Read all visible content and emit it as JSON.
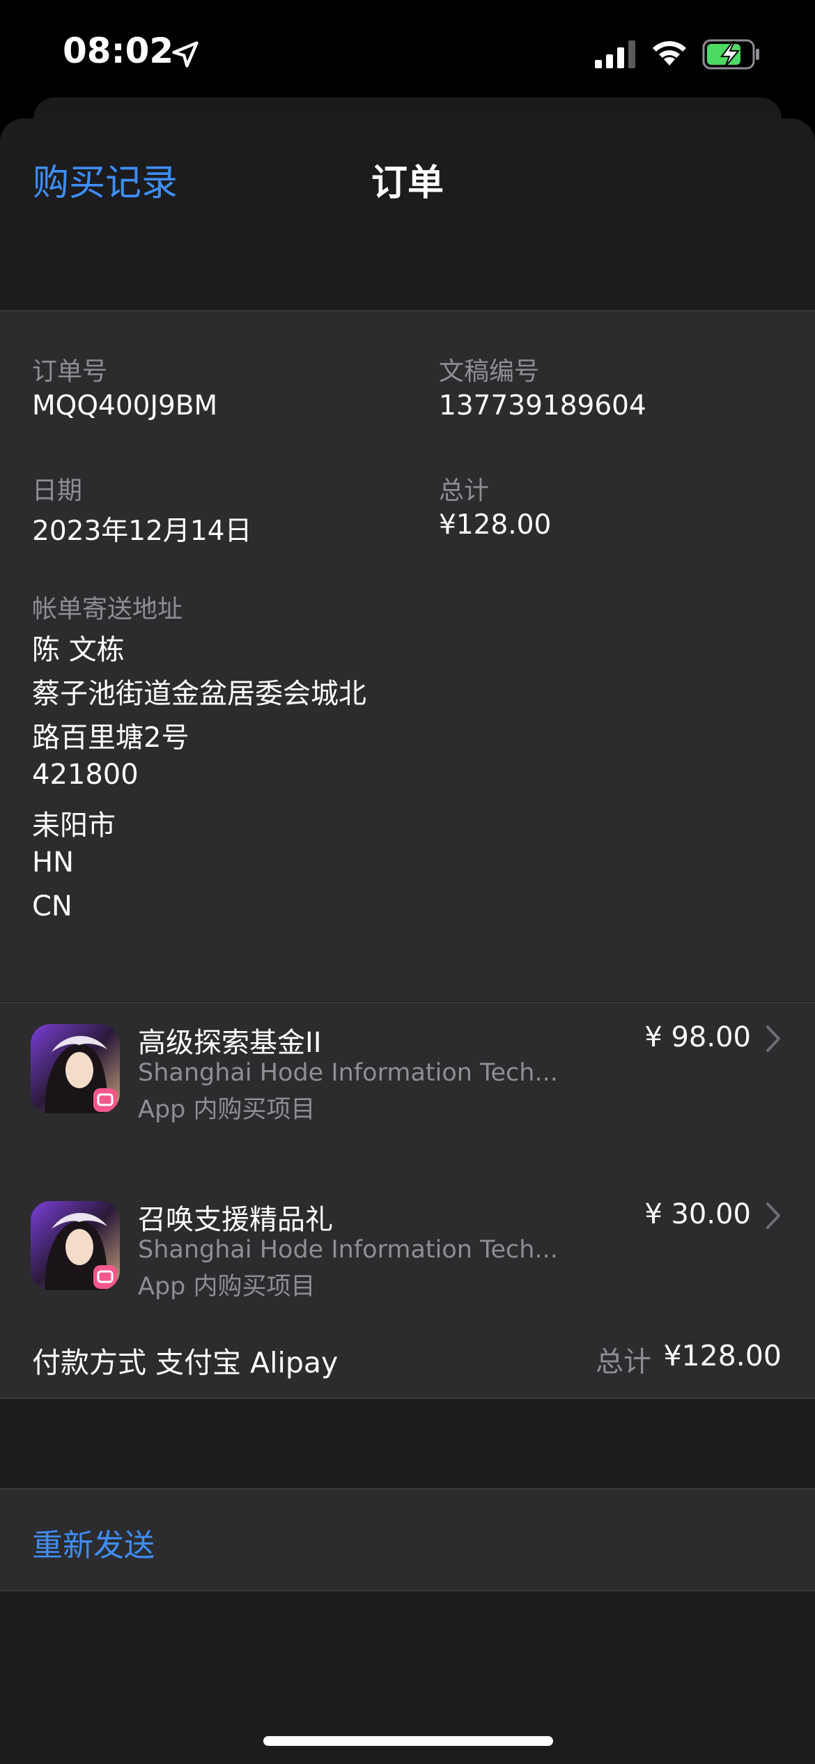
{
  "status_bar": {
    "time": "08:02",
    "icons": [
      "location-arrow-icon",
      "cellular-signal-icon",
      "wifi-icon",
      "battery-charging-icon"
    ],
    "battery_color": "#4cd964"
  },
  "nav": {
    "back_label": "购买记录",
    "title": "订单"
  },
  "order": {
    "order_number_label": "订单号",
    "order_number": "MQQ400J9BM",
    "document_number_label": "文稿编号",
    "document_number": "137739189604",
    "date_label": "日期",
    "date": "2023年12月14日",
    "total_label": "总计",
    "total": "¥128.00",
    "billing_address_label": "帐单寄送地址",
    "billing_address": [
      "陈 文栋",
      "蔡子池街道金盆居委会城北",
      "路百里塘2号",
      "421800",
      "耒阳市",
      "HN",
      "CN"
    ]
  },
  "items": [
    {
      "title": "高级探索基金II",
      "developer": "Shanghai Hode Information Tech...",
      "type": "App 内购买项目",
      "price": "¥ 98.00",
      "icon": "game-app-icon"
    },
    {
      "title": "召唤支援精品礼",
      "developer": "Shanghai Hode Information Tech...",
      "type": "App 内购买项目",
      "price": "¥ 30.00",
      "icon": "game-app-icon"
    }
  ],
  "payment": {
    "method": "付款方式 支付宝 Alipay",
    "total_label": "总计",
    "total": "¥128.00"
  },
  "actions": {
    "resend_label": "重新发送"
  },
  "colors": {
    "accent": "#3e8ef7",
    "background": "#1c1c1e",
    "card": "#2c2c2e",
    "secondary_text": "#8e8e93"
  }
}
